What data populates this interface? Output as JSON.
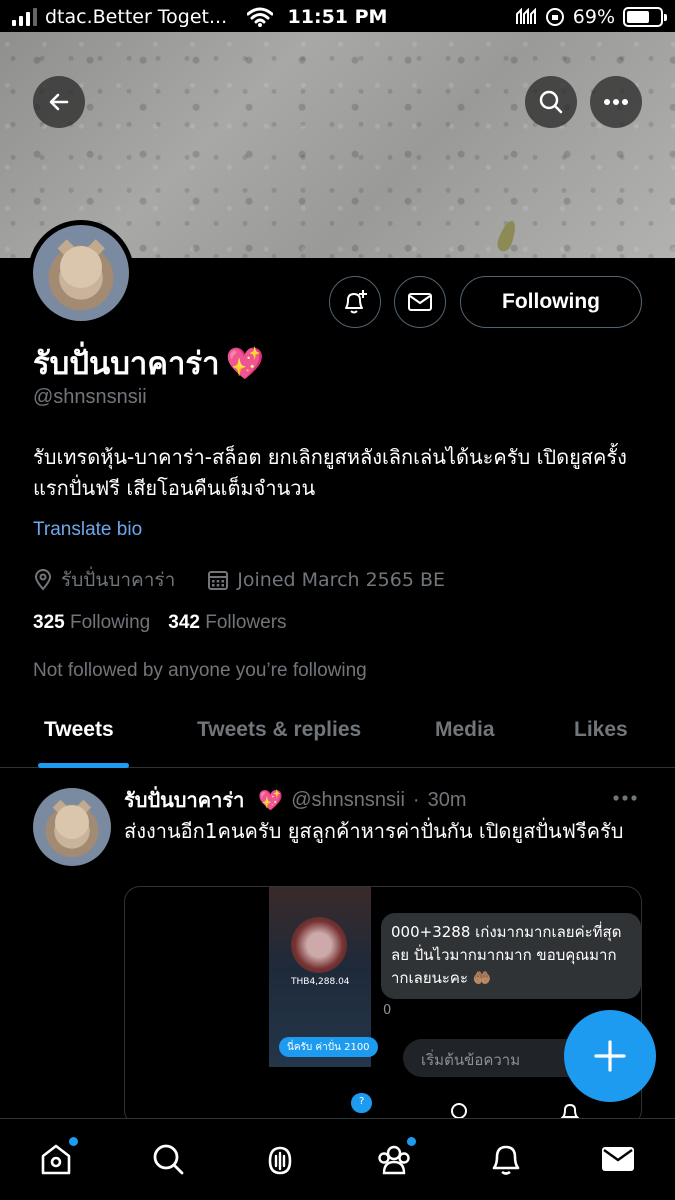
{
  "status_bar": {
    "carrier": "dtac.Better Toget...",
    "time": "11:51 PM",
    "battery": "69%",
    "battery_level": 0.69
  },
  "profile": {
    "display_name": "รับปั่นบาคาร่า",
    "name_emoji": "💖",
    "handle": "@shnsnsnsii",
    "following_button": "Following",
    "bio": "รับเทรดหุ้น-บาคาร่า-สล็อต ยกเลิกยูสหลังเลิกเล่นได้นะครับ เปิดยูสครั้งแรกปั่นฟรี เสียโอนคืนเต็มจำนวน",
    "translate_bio": "Translate bio",
    "location": "รับปั่นบาคาร่า",
    "joined": "Joined March 2565 BE",
    "following_count": "325",
    "following_label": "Following",
    "followers_count": "342",
    "followers_label": "Followers",
    "not_followed": "Not followed by anyone you’re following"
  },
  "tabs": [
    {
      "label": "Tweets",
      "active": true
    },
    {
      "label": "Tweets & replies",
      "active": false
    },
    {
      "label": "Media",
      "active": false
    },
    {
      "label": "Likes",
      "active": false
    }
  ],
  "tweet": {
    "name": "รับปั่นบาคาร่า",
    "emoji": "💖",
    "handle": "@shnsnsnsii",
    "dot": "·",
    "time": "30m",
    "text": "ส่งงานอีก1คนครับ ยูสลูกค้าหารค่าปั่นกัน เปิดยูสปั่นฟรีครับ",
    "media": {
      "chat_text": "000+3288 เก่งมากมากเลยค่ะที่สุด ลย ปั่นไวมากมากมาก ขอบคุณมาก ากเลยนะคะ 🤲🏽",
      "chat_extra": "0",
      "input_placeholder": "เริ่มต้นข้อความ",
      "phone_bubble_1": "นี่ครับ ค่าปั่น 2100",
      "phone_bubble_2": "?",
      "phone_balance": "THB4,288.04"
    }
  },
  "icons": {
    "back": "arrow-left-icon",
    "search": "search-icon",
    "more": "more-horizontal-icon",
    "notify": "bell-plus-icon",
    "message": "envelope-icon",
    "location": "location-pin-icon",
    "calendar": "calendar-icon",
    "compose": "plus-icon"
  },
  "bottom_nav": [
    "home-icon",
    "search-icon",
    "spaces-icon",
    "communities-icon",
    "notifications-icon",
    "messages-icon"
  ],
  "colors": {
    "accent": "#1d9bf0",
    "link": "#6ea8ea",
    "muted": "#71767b",
    "background": "#000000"
  }
}
